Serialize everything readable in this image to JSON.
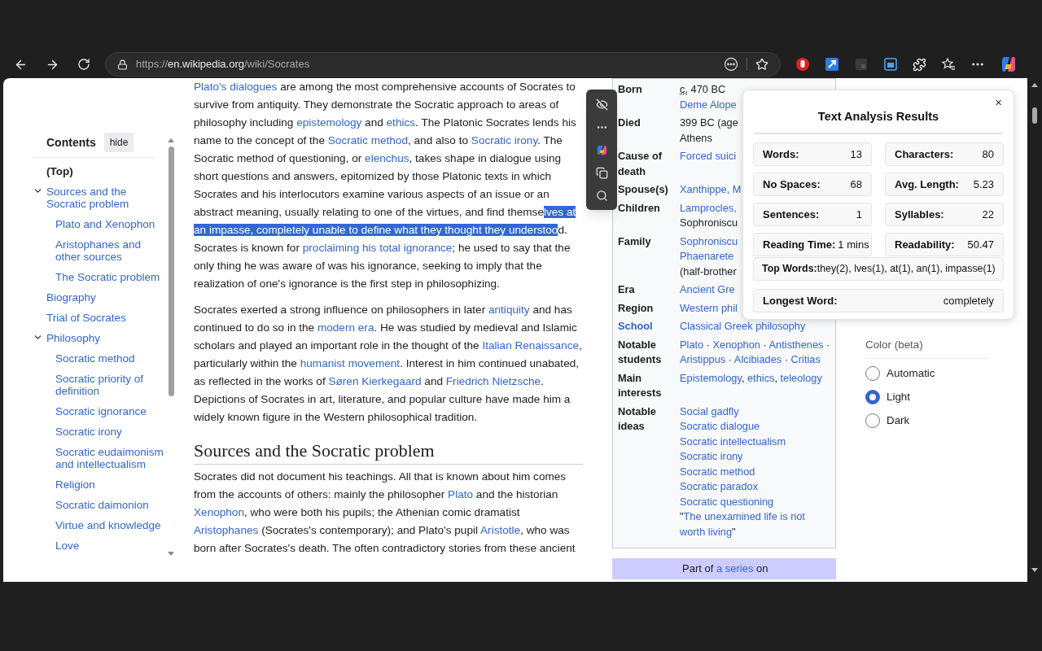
{
  "browser": {
    "url": {
      "scheme": "https://",
      "host": "en.wikipedia.org",
      "path": "/wiki/Socrates"
    }
  },
  "toc": {
    "title": "Contents",
    "hide_label": "hide",
    "items": [
      {
        "label": "(Top)",
        "kind": "top"
      },
      {
        "label": "Sources and the Socratic problem",
        "kind": "section",
        "expanded": true,
        "children": [
          {
            "label": "Plato and Xenophon",
            "kind": "section"
          },
          {
            "label": "Aristophanes and other sources",
            "kind": "section"
          },
          {
            "label": "The Socratic problem",
            "kind": "section"
          }
        ]
      },
      {
        "label": "Biography",
        "kind": "section"
      },
      {
        "label": "Trial of Socrates",
        "kind": "section"
      },
      {
        "label": "Philosophy",
        "kind": "section",
        "expanded": true,
        "children": [
          {
            "label": "Socratic method",
            "kind": "section"
          },
          {
            "label": "Socratic priority of definition",
            "kind": "section"
          },
          {
            "label": "Socratic ignorance",
            "kind": "section"
          },
          {
            "label": "Socratic irony",
            "kind": "section"
          },
          {
            "label": "Socratic eudaimonism and intellectualism",
            "kind": "section"
          },
          {
            "label": "Religion",
            "kind": "section"
          },
          {
            "label": "Socratic daimonion",
            "kind": "section"
          },
          {
            "label": "Virtue and knowledge",
            "kind": "section"
          },
          {
            "label": "Love",
            "kind": "section"
          }
        ]
      }
    ]
  },
  "article": [
    {
      "kind": "paragraph",
      "segments": [
        {
          "kind": "link",
          "text": "Plato's dialogues"
        },
        {
          "kind": "text",
          "text": " are among the most comprehensive accounts of Socrates to survive from antiquity. They demonstrate the Socratic approach to areas of philosophy including "
        },
        {
          "kind": "link",
          "text": "epistemology"
        },
        {
          "kind": "text",
          "text": " and "
        },
        {
          "kind": "link",
          "text": "ethics"
        },
        {
          "kind": "text",
          "text": ". The Platonic Socrates lends his name to the concept of the "
        },
        {
          "kind": "link",
          "text": "Socratic method"
        },
        {
          "kind": "text",
          "text": ", and also to "
        },
        {
          "kind": "link",
          "text": "Socratic irony"
        },
        {
          "kind": "text",
          "text": ". The Socratic method of questioning, or "
        },
        {
          "kind": "link",
          "text": "elenchus"
        },
        {
          "kind": "text",
          "text": ", takes shape in dialogue using short questions and answers, epitomized by those Platonic texts in which Socrates and his interlocutors examine various aspects of an issue or an abstract meaning, usually relating to one of the virtues, and find themse"
        },
        {
          "kind": "selected",
          "text": "lves at "
        },
        {
          "kind": "selected",
          "text": "an impasse, completely unable to define what they thought they understoo"
        },
        {
          "kind": "text",
          "text": "d. Socrates is known for "
        },
        {
          "kind": "link",
          "text": "proclaiming his total ignorance"
        },
        {
          "kind": "text",
          "text": "; he used to say that the only thing he was aware of was his ignorance, seeking to imply that the realization of one's ignorance is the first step in philosophizing."
        }
      ]
    },
    {
      "kind": "paragraph",
      "segments": [
        {
          "kind": "text",
          "text": "Socrates exerted a strong influence on philosophers in later "
        },
        {
          "kind": "link",
          "text": "antiquity"
        },
        {
          "kind": "text",
          "text": " and has continued to do so in the "
        },
        {
          "kind": "link",
          "text": "modern era"
        },
        {
          "kind": "text",
          "text": ". He was studied by medieval and Islamic scholars and played an important role in the thought of the "
        },
        {
          "kind": "link",
          "text": "Italian Renaissance"
        },
        {
          "kind": "text",
          "text": ", particularly within the "
        },
        {
          "kind": "link",
          "text": "humanist movement"
        },
        {
          "kind": "text",
          "text": ". Interest in him continued unabated, as reflected in the works of "
        },
        {
          "kind": "link",
          "text": "Søren Kierkegaard"
        },
        {
          "kind": "text",
          "text": " and "
        },
        {
          "kind": "link",
          "text": "Friedrich Nietzsche"
        },
        {
          "kind": "text",
          "text": ". Depictions of Socrates in art, literature, and popular culture have made him a widely known figure in the Western philosophical tradition."
        }
      ]
    },
    {
      "kind": "heading",
      "text": "Sources and the Socratic problem"
    },
    {
      "kind": "paragraph",
      "segments": [
        {
          "kind": "text",
          "text": "Socrates did not document his teachings. All that is known about him comes from the accounts of others: mainly the philosopher "
        },
        {
          "kind": "link",
          "text": "Plato"
        },
        {
          "kind": "text",
          "text": " and the historian "
        },
        {
          "kind": "link",
          "text": "Xenophon"
        },
        {
          "kind": "text",
          "text": ", who were both his pupils; the Athenian comic dramatist "
        },
        {
          "kind": "link",
          "text": "Aristophanes"
        },
        {
          "kind": "text",
          "text": " (Socrates's contemporary); and Plato's pupil "
        },
        {
          "kind": "link",
          "text": "Aristotle"
        },
        {
          "kind": "text",
          "text": ", who was born after Socrates's death. The often contradictory stories from these ancient"
        }
      ]
    }
  ],
  "infobox": {
    "rows": [
      {
        "label": "Born",
        "label_link": false,
        "lines": [
          [
            {
              "kind": "abbr",
              "text": "c."
            },
            {
              "kind": "text",
              "text": " 470 BC"
            }
          ],
          [
            {
              "kind": "link",
              "text": "Deme Alope"
            }
          ]
        ]
      },
      {
        "label": "Died",
        "label_link": false,
        "lines": [
          [
            {
              "kind": "text",
              "text": "399 BC (age"
            }
          ],
          [
            {
              "kind": "text",
              "text": "Athens"
            }
          ]
        ]
      },
      {
        "label": "Cause of death",
        "label_link": false,
        "lines": [
          [
            {
              "kind": "link",
              "text": "Forced suici"
            }
          ]
        ]
      },
      {
        "label": "Spouse(s)",
        "label_link": false,
        "lines": [
          [
            {
              "kind": "link",
              "text": "Xanthippe, M"
            }
          ]
        ]
      },
      {
        "label": "Children",
        "label_link": false,
        "lines": [
          [
            {
              "kind": "link",
              "text": "Lamprocles,"
            }
          ],
          [
            {
              "kind": "text",
              "text": "Sophroniscu"
            }
          ]
        ]
      },
      {
        "label": "Family",
        "label_link": false,
        "lines": [
          [
            {
              "kind": "link",
              "text": "Sophroniscu"
            }
          ],
          [
            {
              "kind": "link",
              "text": "Phaenarete"
            }
          ],
          [
            {
              "kind": "text",
              "text": "(half-brother"
            }
          ]
        ]
      },
      {
        "label": "Era",
        "label_link": false,
        "lines": [
          [
            {
              "kind": "link",
              "text": "Ancient Gre"
            }
          ]
        ]
      },
      {
        "label": "Region",
        "label_link": false,
        "lines": [
          [
            {
              "kind": "link",
              "text": "Western phil"
            }
          ]
        ]
      },
      {
        "label": "School",
        "label_link": true,
        "lines": [
          [
            {
              "kind": "link",
              "text": "Classical Greek philosophy"
            }
          ]
        ]
      },
      {
        "label": "Notable students",
        "label_link": false,
        "lines": [
          [
            {
              "kind": "link",
              "text": "Plato"
            },
            {
              "kind": "text",
              "text": " · "
            },
            {
              "kind": "link",
              "text": "Xenophon"
            },
            {
              "kind": "text",
              "text": " · "
            },
            {
              "kind": "link",
              "text": "Antisthenes"
            },
            {
              "kind": "text",
              "text": " ·"
            }
          ],
          [
            {
              "kind": "link",
              "text": "Aristippus"
            },
            {
              "kind": "text",
              "text": " · "
            },
            {
              "kind": "link",
              "text": "Alcibiades"
            },
            {
              "kind": "text",
              "text": " · "
            },
            {
              "kind": "link",
              "text": "Critias"
            }
          ]
        ]
      },
      {
        "label": "Main interests",
        "label_link": false,
        "lines": [
          [
            {
              "kind": "link",
              "text": "Epistemology"
            },
            {
              "kind": "text",
              "text": ", "
            },
            {
              "kind": "link",
              "text": "ethics"
            },
            {
              "kind": "text",
              "text": ", "
            },
            {
              "kind": "link",
              "text": "teleology"
            }
          ]
        ]
      },
      {
        "label": "Notable ideas",
        "label_link": false,
        "lines": [
          [
            {
              "kind": "link",
              "text": "Social gadfly"
            }
          ],
          [
            {
              "kind": "link",
              "text": "Socratic dialogue"
            }
          ],
          [
            {
              "kind": "link",
              "text": "Socratic intellectualism"
            }
          ],
          [
            {
              "kind": "link",
              "text": "Socratic irony"
            }
          ],
          [
            {
              "kind": "link",
              "text": "Socratic method"
            }
          ],
          [
            {
              "kind": "link",
              "text": "Socratic paradox"
            }
          ],
          [
            {
              "kind": "link",
              "text": "Socratic questioning"
            }
          ],
          [
            {
              "kind": "text",
              "text": "\""
            },
            {
              "kind": "link",
              "text": "The unexamined life is not"
            }
          ],
          [
            {
              "kind": "link",
              "text": "worth living"
            },
            {
              "kind": "text",
              "text": "\""
            }
          ]
        ]
      }
    ],
    "series": [
      {
        "kind": "text",
        "text": "Part of "
      },
      {
        "kind": "link",
        "text": "a series"
      },
      {
        "kind": "text",
        "text": " on"
      }
    ]
  },
  "appearance": {
    "title": "Color (beta)",
    "options": [
      {
        "label": "Automatic",
        "selected": false
      },
      {
        "label": "Light",
        "selected": true
      },
      {
        "label": "Dark",
        "selected": false
      }
    ]
  },
  "analysis": {
    "title": "Text Analysis Results",
    "close": "×",
    "stats": [
      {
        "label": "Words:",
        "value": "13"
      },
      {
        "label": "Characters:",
        "value": "80"
      },
      {
        "label": "No Spaces:",
        "value": "68"
      },
      {
        "label": "Avg. Length:",
        "value": "5.23"
      },
      {
        "label": "Sentences:",
        "value": "1"
      },
      {
        "label": "Syllables:",
        "value": "22"
      },
      {
        "label": "Reading Time:",
        "value": "1 mins"
      },
      {
        "label": "Readability:",
        "value": "50.47"
      }
    ],
    "top_words": {
      "label": "Top Words:",
      "value": "they(2), lves(1), at(1), an(1), impasse(1)"
    },
    "longest_word": {
      "label": "Longest Word:",
      "value": "completely"
    }
  }
}
